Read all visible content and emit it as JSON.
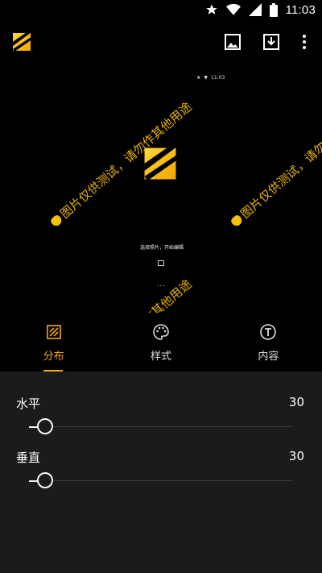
{
  "status_bar": {
    "time": "11:03",
    "icons": [
      "star-icon",
      "wifi-icon",
      "signal-icon",
      "battery-icon"
    ]
  },
  "toolbar": {
    "logo_icon": "watermark-logo-icon",
    "actions": [
      "image-icon",
      "download-icon",
      "more-vert-icon"
    ]
  },
  "preview": {
    "watermark_text": "图片仅供测试，请勿作其他用途",
    "mini_time": "11:03",
    "mini_caption": "选择照片，开始编辑",
    "mini_dots": "...",
    "colors": {
      "watermark": "#e7b10b",
      "logo_yellow": "#f7c81a"
    }
  },
  "tabs": [
    {
      "label": "分布",
      "icon": "distribution-icon",
      "active": true
    },
    {
      "label": "样式",
      "icon": "palette-icon",
      "active": false
    },
    {
      "label": "内容",
      "icon": "text-content-icon",
      "active": false
    }
  ],
  "settings": {
    "horizontal": {
      "label": "水平",
      "value": "30",
      "fraction": 0.06
    },
    "vertical": {
      "label": "垂直",
      "value": "30",
      "fraction": 0.06
    }
  },
  "colors": {
    "accent": "#f6a623",
    "panel_bg": "#1b1b1b",
    "background": "#000000"
  }
}
